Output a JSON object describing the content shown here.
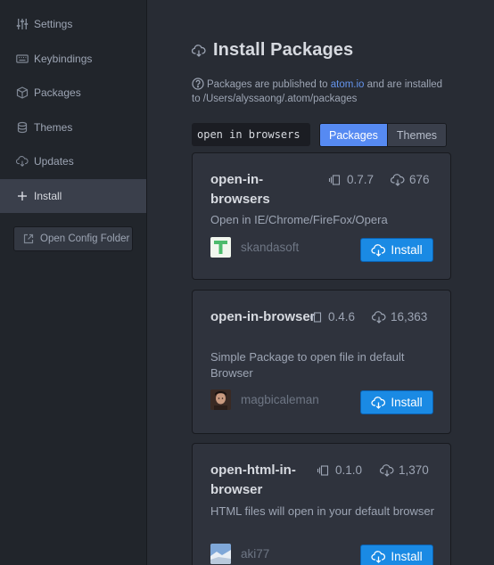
{
  "sidebar": {
    "items": [
      {
        "label": "Settings",
        "icon": "sliders-icon"
      },
      {
        "label": "Keybindings",
        "icon": "keyboard-icon"
      },
      {
        "label": "Packages",
        "icon": "package-icon"
      },
      {
        "label": "Themes",
        "icon": "paintcan-icon"
      },
      {
        "label": "Updates",
        "icon": "cloud-download-icon"
      },
      {
        "label": "Install",
        "icon": "plus-icon",
        "active": true
      }
    ],
    "config_button": "Open Config Folder"
  },
  "main": {
    "title": "Install Packages",
    "info_prefix": "Packages are published to ",
    "info_link": "atom.io",
    "info_suffix": " and are installed to /Users/alyssaong/.atom/packages",
    "search_value": "open in browsers",
    "toggle": {
      "packages": "Packages",
      "themes": "Themes",
      "selected": "Packages"
    }
  },
  "packages": [
    {
      "name": "open-in-browsers",
      "version": "0.7.7",
      "downloads": "676",
      "description": "Open in IE/Chrome/FireFox/Opera",
      "author": "skandasoft",
      "install_label": "Install"
    },
    {
      "name": "open-in-browser",
      "version": "0.4.6",
      "downloads": "16,363",
      "description": "Simple Package to open file in default Browser",
      "author": "magbicaleman",
      "install_label": "Install"
    },
    {
      "name": "open-html-in-browser",
      "version": "0.1.0",
      "downloads": "1,370",
      "description": "HTML files will open in your default browser",
      "author": "aki77",
      "install_label": "Install"
    }
  ],
  "colors": {
    "accent": "#568af2",
    "install_button": "#1a8ae4",
    "link": "#6494ed"
  }
}
